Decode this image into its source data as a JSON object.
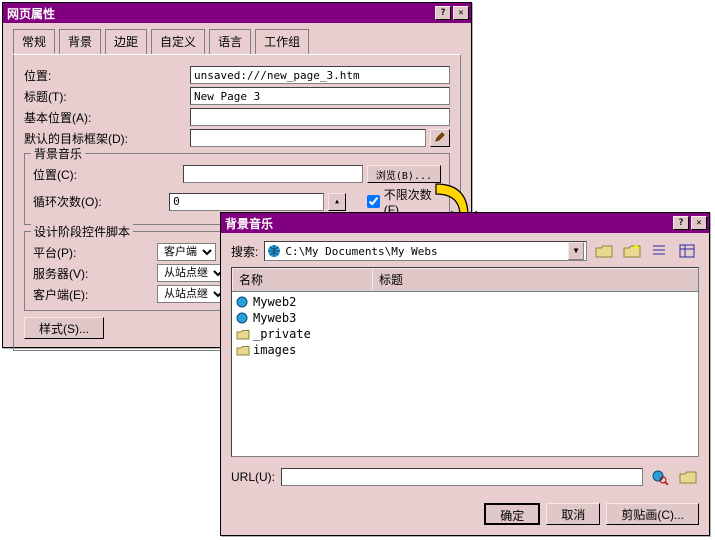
{
  "dialog1": {
    "title": "网页属性",
    "tabs": [
      "常规",
      "背景",
      "边距",
      "自定义",
      "语言",
      "工作组"
    ],
    "fields": {
      "location_label": "位置:",
      "location_value": "unsaved:///new_page_3.htm",
      "title_label": "标题(T):",
      "title_value": "New Page 3",
      "base_label": "基本位置(A):",
      "base_value": "",
      "frame_label": "默认的目标框架(D):",
      "frame_value": ""
    },
    "bg_music": {
      "legend": "背景音乐",
      "loc_label": "位置(C):",
      "loc_value": "",
      "browse_btn": "浏览(B)...",
      "loop_label": "循环次数(O):",
      "loop_value": "0",
      "unlimited_label": "不限次数(F)"
    },
    "script": {
      "legend": "设计阶段控件脚本",
      "platform_label": "平台(P):",
      "platform_value": "客户端",
      "server_label": "服务器(V):",
      "server_value": "从站点继",
      "client_label": "客户端(E):",
      "client_value": "从站点继"
    },
    "style_btn": "样式(S)..."
  },
  "dialog2": {
    "title": "背景音乐",
    "search_label": "搜索:",
    "combo_value": "C:\\My Documents\\My Webs",
    "columns": {
      "name": "名称",
      "title": "标题"
    },
    "items": [
      {
        "name": "Myweb2",
        "type": "web"
      },
      {
        "name": "Myweb3",
        "type": "web"
      },
      {
        "name": "_private",
        "type": "folder"
      },
      {
        "name": "images",
        "type": "folder"
      }
    ],
    "url_label": "URL(U):",
    "url_value": "",
    "buttons": {
      "ok": "确定",
      "cancel": "取消",
      "clip": "剪贴画(C)..."
    }
  }
}
